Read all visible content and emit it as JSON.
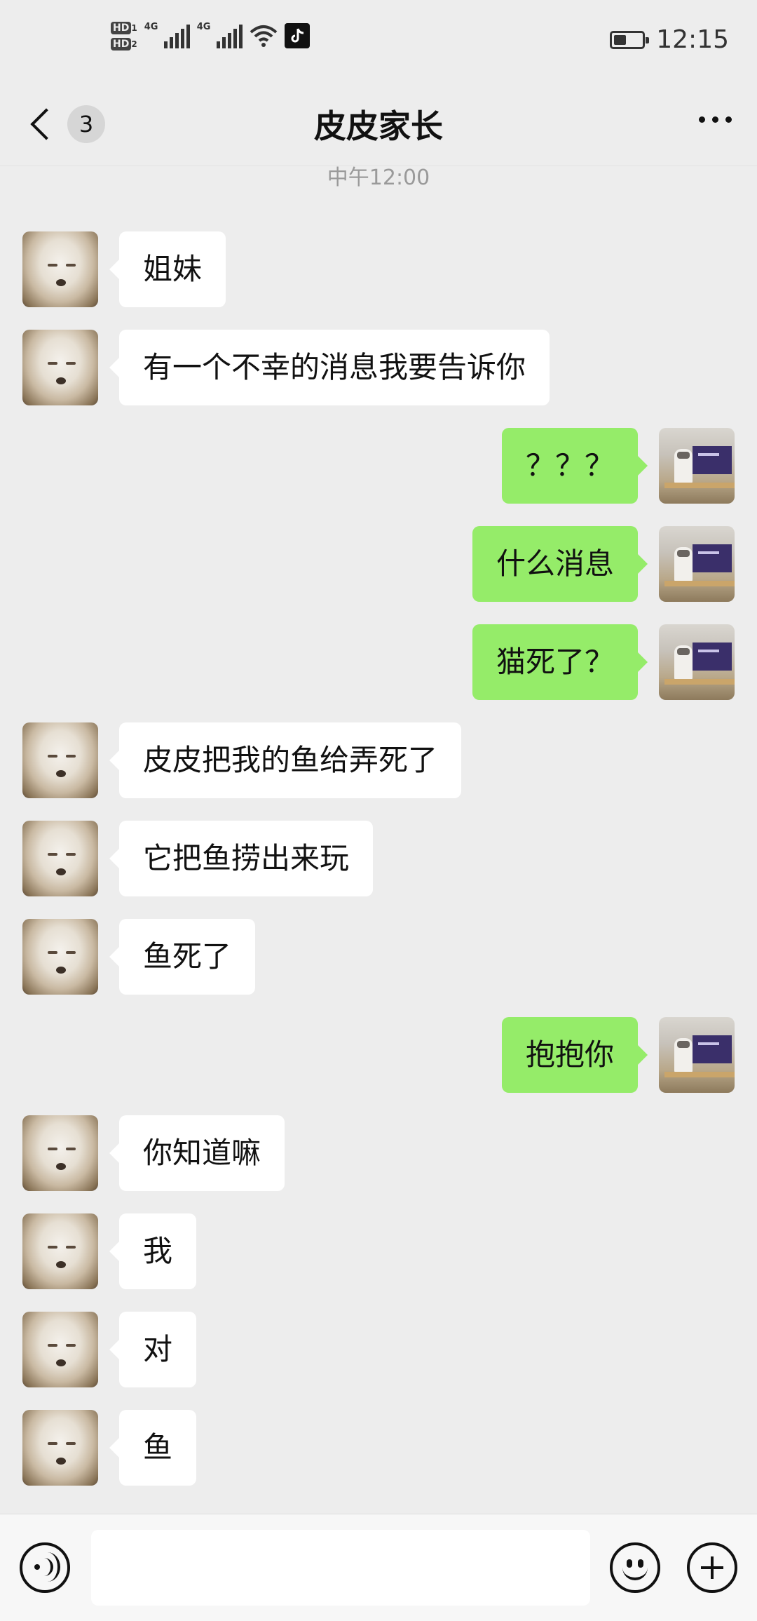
{
  "status_bar": {
    "hd1": "HD",
    "hd1_sub": "1",
    "hd2": "HD",
    "hd2_sub": "2",
    "net1": "4G",
    "net2": "4G",
    "tiktok_icon": "tiktok-icon",
    "battery_level": 0.45,
    "time": "12:15"
  },
  "nav": {
    "back_icon": "chevron-left-icon",
    "unread_count": "3",
    "title": "皮皮家长",
    "more_icon": "more-icon"
  },
  "chat": {
    "time_separator": "中午12:00",
    "messages": [
      {
        "side": "in",
        "text": "姐妹"
      },
      {
        "side": "in",
        "text": "有一个不幸的消息我要告诉你"
      },
      {
        "side": "out",
        "text": "？？？"
      },
      {
        "side": "out",
        "text": "什么消息"
      },
      {
        "side": "out",
        "text": "猫死了？"
      },
      {
        "side": "in",
        "text": "皮皮把我的鱼给弄死了"
      },
      {
        "side": "in",
        "text": "它把鱼捞出来玩"
      },
      {
        "side": "in",
        "text": "鱼死了"
      },
      {
        "side": "out",
        "text": "抱抱你"
      },
      {
        "side": "in",
        "text": "你知道嘛"
      },
      {
        "side": "in",
        "text": "我"
      },
      {
        "side": "in",
        "text": "对"
      },
      {
        "side": "in",
        "text": "鱼"
      }
    ]
  },
  "input_bar": {
    "voice_icon": "voice-icon",
    "input_value": "",
    "emoji_icon": "emoji-icon",
    "plus_icon": "plus-icon"
  },
  "colors": {
    "background": "#ededed",
    "outgoing_bubble": "#95ec69",
    "incoming_bubble": "#ffffff"
  }
}
